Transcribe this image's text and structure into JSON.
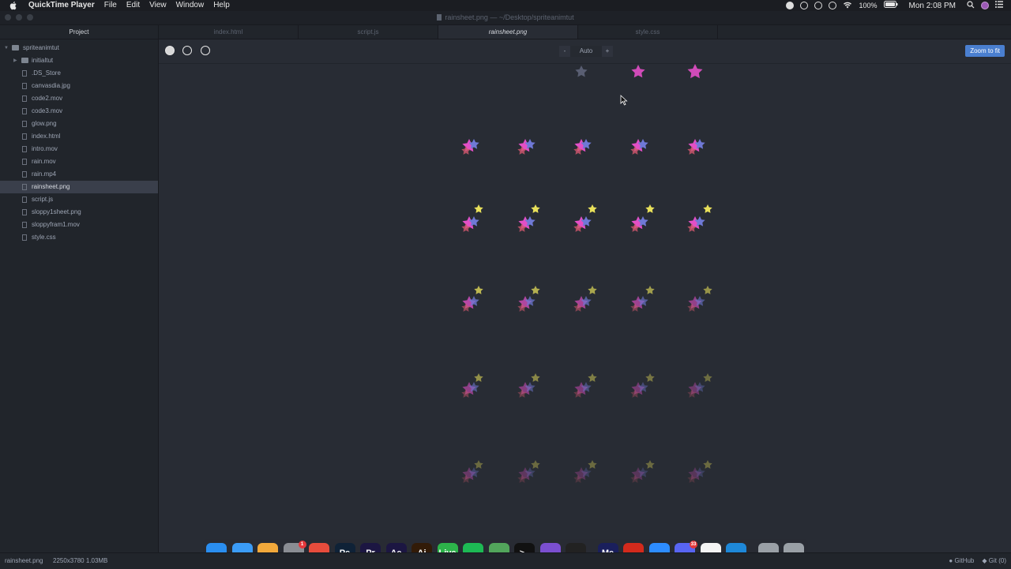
{
  "menubar": {
    "app_name": "QuickTime Player",
    "items": [
      "File",
      "Edit",
      "View",
      "Window",
      "Help"
    ],
    "battery": "100%",
    "clock": "Mon 2:08 PM"
  },
  "window": {
    "title": "rainsheet.png — ~/Desktop/spriteanimtut"
  },
  "sidebar": {
    "header": "Project",
    "root": "spriteanimtut",
    "items": [
      {
        "label": "initialtut",
        "kind": "folder"
      },
      {
        "label": ".DS_Store",
        "kind": "file"
      },
      {
        "label": "canvasdia.jpg",
        "kind": "file"
      },
      {
        "label": "code2.mov",
        "kind": "file"
      },
      {
        "label": "code3.mov",
        "kind": "file"
      },
      {
        "label": "glow.png",
        "kind": "file"
      },
      {
        "label": "index.html",
        "kind": "file"
      },
      {
        "label": "intro.mov",
        "kind": "file"
      },
      {
        "label": "rain.mov",
        "kind": "file"
      },
      {
        "label": "rain.mp4",
        "kind": "file"
      },
      {
        "label": "rainsheet.png",
        "kind": "file",
        "selected": true
      },
      {
        "label": "script.js",
        "kind": "file"
      },
      {
        "label": "sloppy1sheet.png",
        "kind": "file"
      },
      {
        "label": "sloppyfram1.mov",
        "kind": "file"
      },
      {
        "label": "style.css",
        "kind": "file"
      }
    ]
  },
  "tabs": [
    {
      "label": "index.html",
      "active": false
    },
    {
      "label": "script.js",
      "active": false
    },
    {
      "label": "rainsheet.png",
      "active": true
    },
    {
      "label": "style.css",
      "active": false
    }
  ],
  "viewer": {
    "zoom_minus": "-",
    "zoom_value": "Auto",
    "zoom_plus": "+",
    "zoom_fit": "Zoom to fit"
  },
  "statusbar": {
    "filename": "rainsheet.png",
    "meta": "2250x3780 1.03MB",
    "github": "GitHub",
    "git": "Git (0)"
  },
  "dock": {
    "icons": [
      {
        "name": "finder",
        "text": "",
        "color": "#2a8ef0"
      },
      {
        "name": "messages",
        "text": "",
        "color": "#3b9cf7"
      },
      {
        "name": "photos",
        "text": "",
        "color": "#f2a93b"
      },
      {
        "name": "system-preferences",
        "text": "",
        "color": "#8a8d93",
        "badge": "1"
      },
      {
        "name": "chrome",
        "text": "",
        "color": "#e74c3c"
      },
      {
        "name": "photoshop",
        "text": "Ps",
        "color": "#0f2237"
      },
      {
        "name": "premiere",
        "text": "Pr",
        "color": "#1c1642"
      },
      {
        "name": "after-effects",
        "text": "Ae",
        "color": "#1c1642"
      },
      {
        "name": "illustrator",
        "text": "Ai",
        "color": "#321b08"
      },
      {
        "name": "live",
        "text": "Live",
        "color": "#2db34a"
      },
      {
        "name": "spotify",
        "text": "",
        "color": "#1db954"
      },
      {
        "name": "atom",
        "text": "",
        "color": "#52a55b"
      },
      {
        "name": "terminal",
        "text": ">_",
        "color": "#111111"
      },
      {
        "name": "visual-studio",
        "text": "",
        "color": "#7b4fd0"
      },
      {
        "name": "unity",
        "text": "",
        "color": "#222222"
      },
      {
        "name": "media-encoder",
        "text": "Me",
        "color": "#1a1f5c"
      },
      {
        "name": "acrobat",
        "text": "",
        "color": "#d32a1c"
      },
      {
        "name": "zoom",
        "text": "",
        "color": "#2d8cff"
      },
      {
        "name": "discord",
        "text": "",
        "color": "#5865f2",
        "badge": "33"
      },
      {
        "name": "textedit",
        "text": "",
        "color": "#f4f4f4"
      },
      {
        "name": "edge",
        "text": "",
        "color": "#1e88d8"
      },
      {
        "name": "archive",
        "text": "",
        "color": "#9aa0a6"
      },
      {
        "name": "trash",
        "text": "",
        "color": "#9aa0a6"
      }
    ]
  }
}
